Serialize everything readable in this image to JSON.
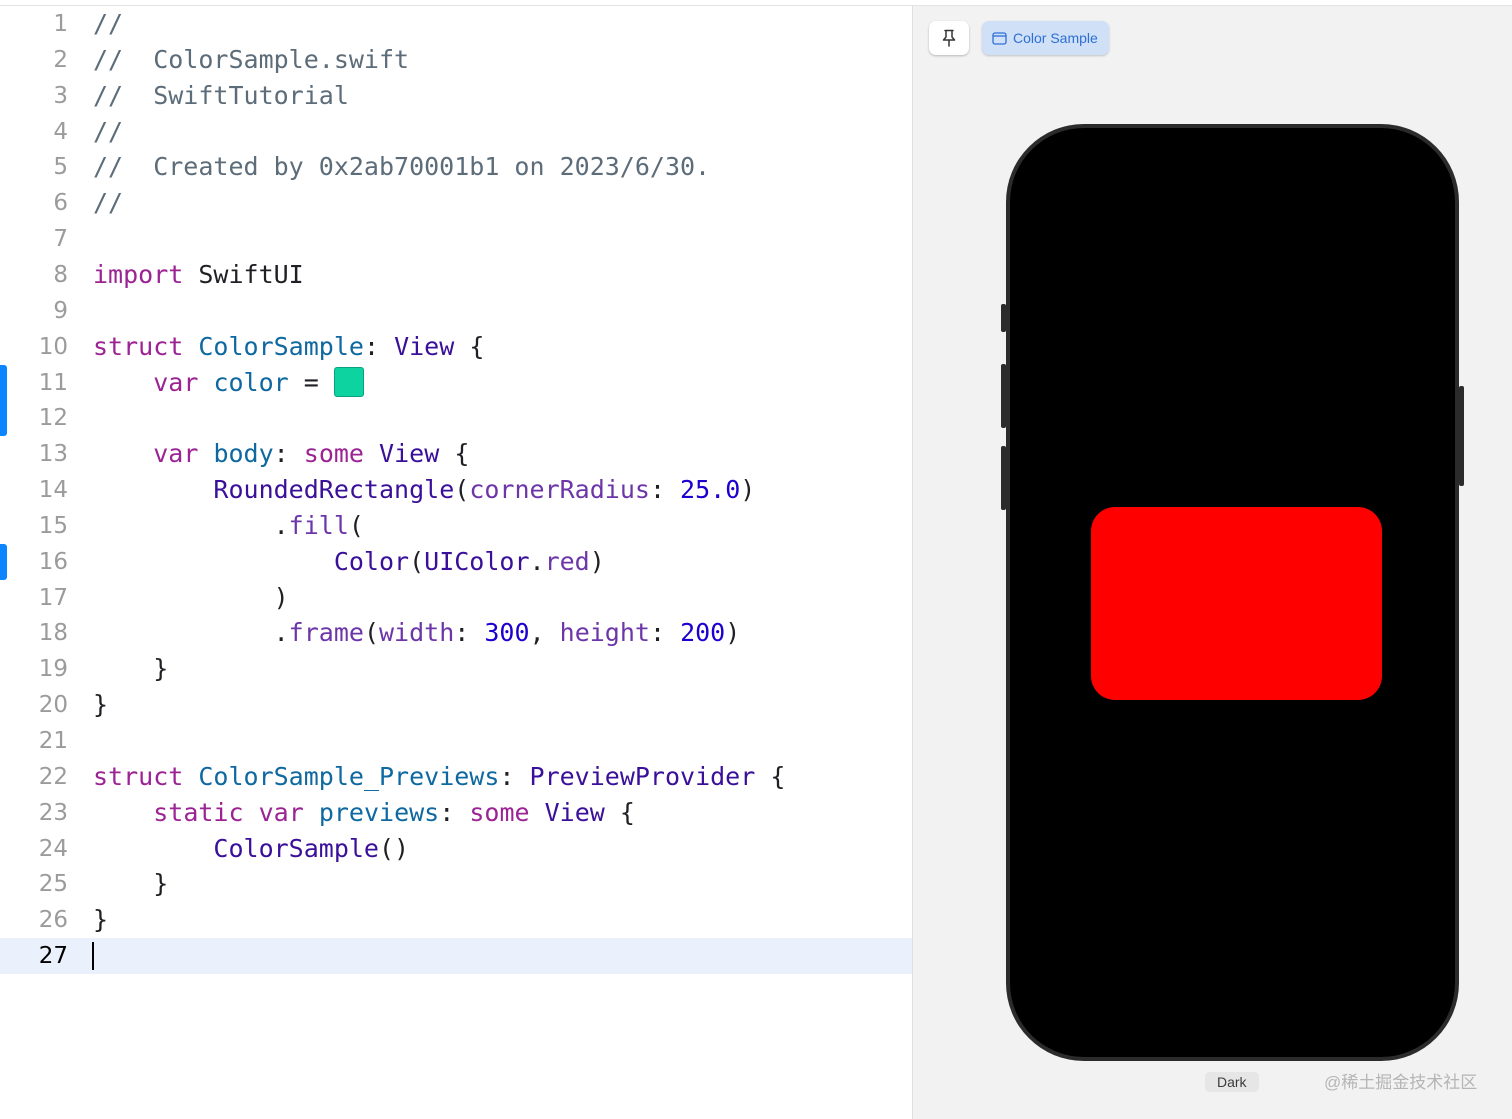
{
  "editor": {
    "current_line": 27,
    "lines": [
      {
        "n": "1",
        "tokens": [
          {
            "t": "//",
            "c": "comment"
          }
        ]
      },
      {
        "n": "2",
        "tokens": [
          {
            "t": "//  ColorSample.swift",
            "c": "comment"
          }
        ]
      },
      {
        "n": "3",
        "tokens": [
          {
            "t": "//  SwiftTutorial",
            "c": "comment"
          }
        ]
      },
      {
        "n": "4",
        "tokens": [
          {
            "t": "//",
            "c": "comment"
          }
        ]
      },
      {
        "n": "5",
        "tokens": [
          {
            "t": "//  Created by 0x2ab70001b1 on 2023/6/30.",
            "c": "comment"
          }
        ]
      },
      {
        "n": "6",
        "tokens": [
          {
            "t": "//",
            "c": "comment"
          }
        ]
      },
      {
        "n": "7",
        "tokens": []
      },
      {
        "n": "8",
        "tokens": [
          {
            "t": "import",
            "c": "kw"
          },
          {
            "t": " SwiftUI",
            "c": "plain"
          }
        ]
      },
      {
        "n": "9",
        "tokens": []
      },
      {
        "n": "10",
        "tokens": [
          {
            "t": "struct",
            "c": "kw"
          },
          {
            "t": " ",
            "c": "plain"
          },
          {
            "t": "ColorSample",
            "c": "decl"
          },
          {
            "t": ": ",
            "c": "plain"
          },
          {
            "t": "View",
            "c": "type"
          },
          {
            "t": " {",
            "c": "plain"
          }
        ]
      },
      {
        "n": "11",
        "tokens": [
          {
            "t": "    ",
            "c": "plain"
          },
          {
            "t": "var",
            "c": "kw"
          },
          {
            "t": " ",
            "c": "plain"
          },
          {
            "t": "color",
            "c": "decl"
          },
          {
            "t": " = ",
            "c": "plain"
          },
          {
            "swatch": "#0dd3a0"
          }
        ]
      },
      {
        "n": "12",
        "tokens": []
      },
      {
        "n": "13",
        "tokens": [
          {
            "t": "    ",
            "c": "plain"
          },
          {
            "t": "var",
            "c": "kw"
          },
          {
            "t": " ",
            "c": "plain"
          },
          {
            "t": "body",
            "c": "decl"
          },
          {
            "t": ": ",
            "c": "plain"
          },
          {
            "t": "some",
            "c": "kw"
          },
          {
            "t": " ",
            "c": "plain"
          },
          {
            "t": "View",
            "c": "type"
          },
          {
            "t": " {",
            "c": "plain"
          }
        ]
      },
      {
        "n": "14",
        "tokens": [
          {
            "t": "        ",
            "c": "plain"
          },
          {
            "t": "RoundedRectangle",
            "c": "type"
          },
          {
            "t": "(",
            "c": "plain"
          },
          {
            "t": "cornerRadius",
            "c": "member"
          },
          {
            "t": ": ",
            "c": "plain"
          },
          {
            "t": "25.0",
            "c": "num"
          },
          {
            "t": ")",
            "c": "plain"
          }
        ]
      },
      {
        "n": "15",
        "tokens": [
          {
            "t": "            .",
            "c": "plain"
          },
          {
            "t": "fill",
            "c": "member"
          },
          {
            "t": "(",
            "c": "plain"
          }
        ]
      },
      {
        "n": "16",
        "tokens": [
          {
            "t": "                ",
            "c": "plain"
          },
          {
            "t": "Color",
            "c": "type"
          },
          {
            "t": "(",
            "c": "plain"
          },
          {
            "t": "UIColor",
            "c": "type"
          },
          {
            "t": ".",
            "c": "plain"
          },
          {
            "t": "red",
            "c": "member"
          },
          {
            "t": ")",
            "c": "plain"
          }
        ]
      },
      {
        "n": "17",
        "tokens": [
          {
            "t": "            )",
            "c": "plain"
          }
        ]
      },
      {
        "n": "18",
        "tokens": [
          {
            "t": "            .",
            "c": "plain"
          },
          {
            "t": "frame",
            "c": "member"
          },
          {
            "t": "(",
            "c": "plain"
          },
          {
            "t": "width",
            "c": "member"
          },
          {
            "t": ": ",
            "c": "plain"
          },
          {
            "t": "300",
            "c": "num"
          },
          {
            "t": ", ",
            "c": "plain"
          },
          {
            "t": "height",
            "c": "member"
          },
          {
            "t": ": ",
            "c": "plain"
          },
          {
            "t": "200",
            "c": "num"
          },
          {
            "t": ")",
            "c": "plain"
          }
        ]
      },
      {
        "n": "19",
        "tokens": [
          {
            "t": "    }",
            "c": "plain"
          }
        ]
      },
      {
        "n": "20",
        "tokens": [
          {
            "t": "}",
            "c": "plain"
          }
        ]
      },
      {
        "n": "21",
        "tokens": []
      },
      {
        "n": "22",
        "tokens": [
          {
            "t": "struct",
            "c": "kw"
          },
          {
            "t": " ",
            "c": "plain"
          },
          {
            "t": "ColorSample_Previews",
            "c": "decl"
          },
          {
            "t": ": ",
            "c": "plain"
          },
          {
            "t": "PreviewProvider",
            "c": "type"
          },
          {
            "t": " {",
            "c": "plain"
          }
        ]
      },
      {
        "n": "23",
        "tokens": [
          {
            "t": "    ",
            "c": "plain"
          },
          {
            "t": "static",
            "c": "kw"
          },
          {
            "t": " ",
            "c": "plain"
          },
          {
            "t": "var",
            "c": "kw"
          },
          {
            "t": " ",
            "c": "plain"
          },
          {
            "t": "previews",
            "c": "decl"
          },
          {
            "t": ": ",
            "c": "plain"
          },
          {
            "t": "some",
            "c": "kw"
          },
          {
            "t": " ",
            "c": "plain"
          },
          {
            "t": "View",
            "c": "type"
          },
          {
            "t": " {",
            "c": "plain"
          }
        ]
      },
      {
        "n": "24",
        "tokens": [
          {
            "t": "        ",
            "c": "plain"
          },
          {
            "t": "ColorSample",
            "c": "type"
          },
          {
            "t": "()",
            "c": "plain"
          }
        ]
      },
      {
        "n": "25",
        "tokens": [
          {
            "t": "    }",
            "c": "plain"
          }
        ]
      },
      {
        "n": "26",
        "tokens": [
          {
            "t": "}",
            "c": "plain"
          }
        ]
      },
      {
        "n": "27",
        "tokens": []
      }
    ],
    "changed_lines": [
      11,
      12,
      16
    ]
  },
  "preview": {
    "pin_icon": "pin-icon",
    "tab_icon": "preview-window-icon",
    "tab_label": "Color Sample",
    "rect_color": "#ff0000",
    "color_scheme": "Dark",
    "watermark": "@稀土掘金技术社区"
  }
}
